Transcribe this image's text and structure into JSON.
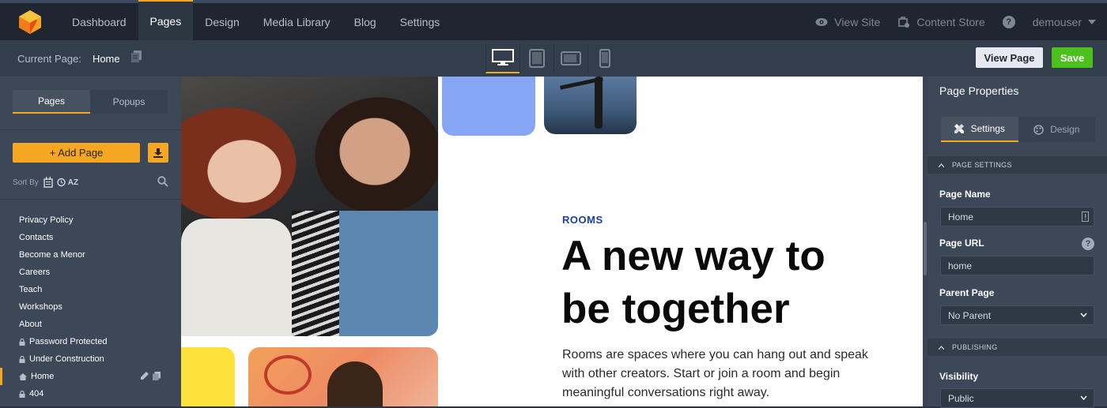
{
  "nav": {
    "items": [
      {
        "label": "Dashboard",
        "active": false
      },
      {
        "label": "Pages",
        "active": true
      },
      {
        "label": "Design",
        "active": false
      },
      {
        "label": "Media Library",
        "active": false
      },
      {
        "label": "Blog",
        "active": false
      },
      {
        "label": "Settings",
        "active": false
      }
    ],
    "view_site": "View Site",
    "content_store": "Content Store",
    "help": "?",
    "user": "demouser"
  },
  "subbar": {
    "current_label": "Current Page:",
    "current_value": "Home",
    "view_page": "View Page",
    "save": "Save",
    "devices": [
      "desktop-icon",
      "tablet-portrait-icon",
      "tablet-landscape-icon",
      "mobile-icon"
    ]
  },
  "sidebar": {
    "tabs": [
      "Pages",
      "Popups"
    ],
    "add_page": "+ Add Page",
    "sort_by": "Sort By",
    "sort_az": "AZ",
    "pages": [
      {
        "label": "Privacy Policy",
        "locked": false
      },
      {
        "label": "Contacts",
        "locked": false
      },
      {
        "label": "Become a Menor",
        "locked": false
      },
      {
        "label": "Careers",
        "locked": false
      },
      {
        "label": "Teach",
        "locked": false
      },
      {
        "label": "Workshops",
        "locked": false
      },
      {
        "label": "About",
        "locked": false
      },
      {
        "label": "Password Protected",
        "locked": true
      },
      {
        "label": "Under Construction",
        "locked": true
      },
      {
        "label": "Home",
        "locked": false,
        "active": true
      },
      {
        "label": "404",
        "locked": true
      }
    ]
  },
  "canvas": {
    "eyebrow": "ROOMS",
    "title_line1": "A new way to",
    "title_line2": "be together",
    "body": "Rooms are spaces where you can hang out and speak with other creators. Start or join a room and begin meaningful conversations right away."
  },
  "panel": {
    "title": "Page Properties",
    "tabs": [
      "Settings",
      "Design"
    ],
    "section_page_settings": "PAGE SETTINGS",
    "page_name_label": "Page Name",
    "page_name_value": "Home",
    "page_url_label": "Page URL",
    "page_url_value": "home",
    "parent_page_label": "Parent Page",
    "parent_page_value": "No Parent",
    "section_publishing": "PUBLISHING",
    "visibility_label": "Visibility",
    "visibility_value": "Public"
  },
  "colors": {
    "accent": "#f5a623",
    "save": "#4cc01c",
    "heading_blue": "#1b3fa0"
  }
}
